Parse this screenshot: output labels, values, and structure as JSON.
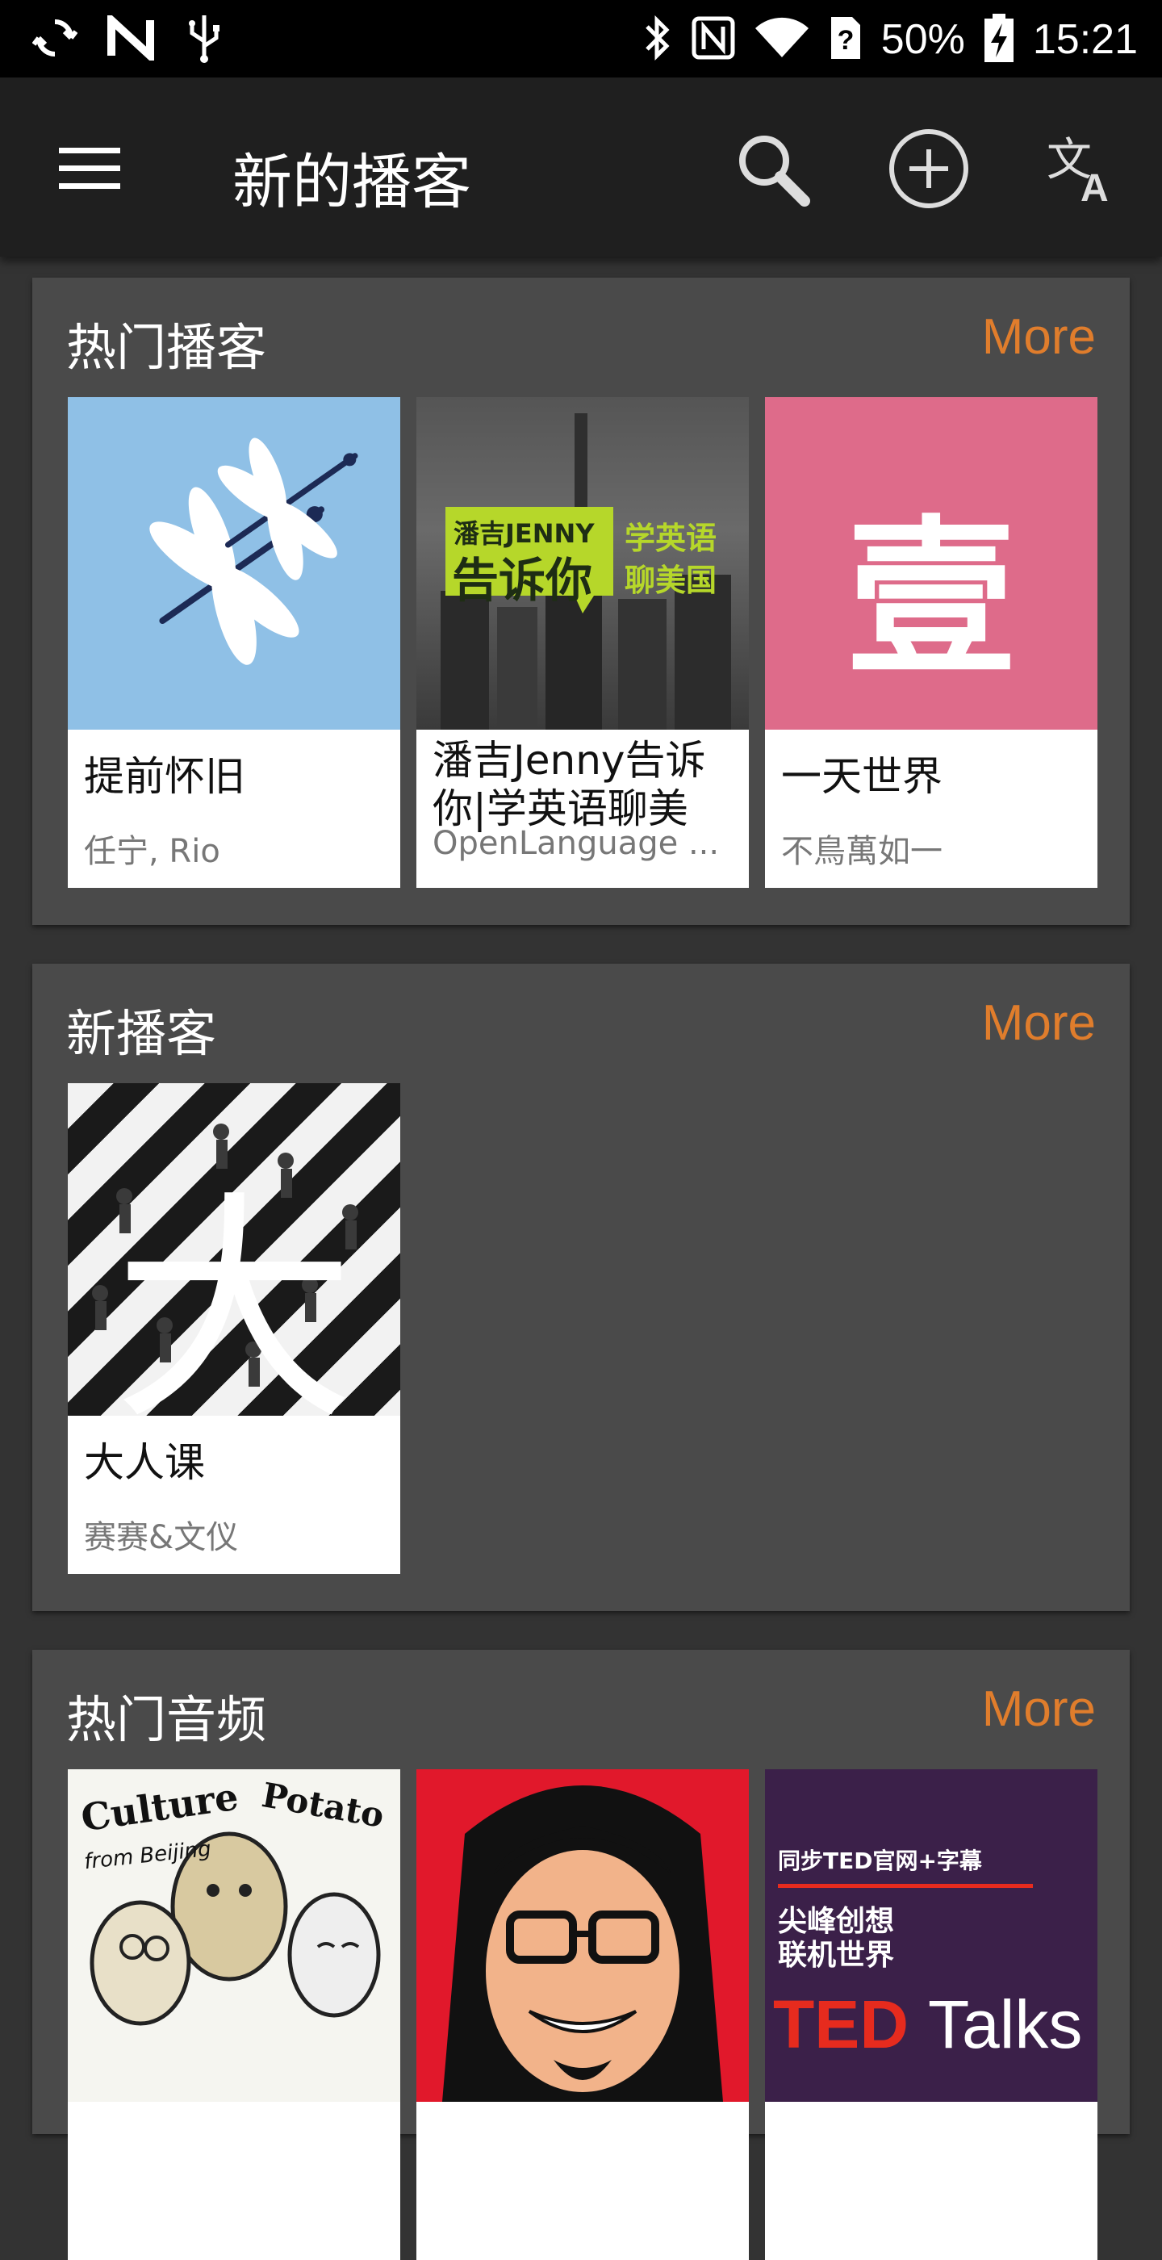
{
  "status_bar": {
    "battery": "50%",
    "time": "15:21"
  },
  "app_bar": {
    "title": "新的播客"
  },
  "sections": [
    {
      "title": "热门播客",
      "more": "More",
      "items": [
        {
          "title": "提前怀旧",
          "author": "任宁, Rio"
        },
        {
          "title": "潘吉Jenny告诉你|学英语聊美",
          "author": "OpenLanguage ...",
          "art_text": {
            "line1": "潘吉JENNY",
            "line2": "告诉你",
            "line3": "学英语",
            "line4": "聊美国"
          }
        },
        {
          "title": "一天世界",
          "author": "不鳥萬如一",
          "art_text": "壹"
        }
      ]
    },
    {
      "title": "新播客",
      "more": "More",
      "items": [
        {
          "title": "大人课",
          "author": "赛赛&文仪",
          "art_text": "大"
        }
      ]
    },
    {
      "title": "热门音频",
      "more": "More",
      "items": [
        {
          "art_text": {
            "line1": "Culture",
            "line2": "Potato",
            "line3": "from Beijing"
          }
        },
        {},
        {
          "art_text": {
            "line1": "同步TED官网+字幕",
            "line2": "尖峰创想",
            "line3": "联机世界",
            "line4": "TED",
            "line5": "Talks"
          }
        }
      ]
    }
  ]
}
